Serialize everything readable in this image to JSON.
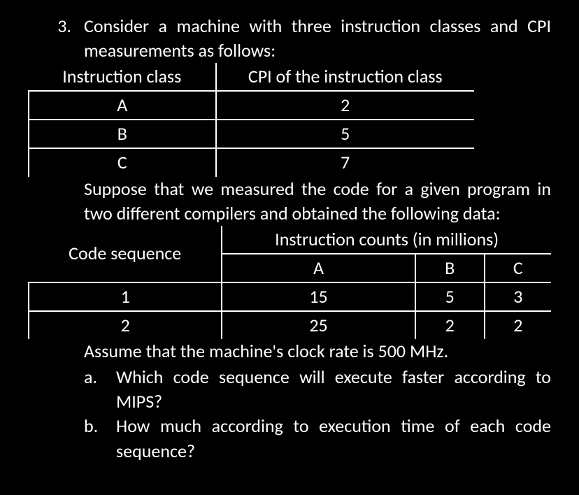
{
  "problem": {
    "number": "3.",
    "intro": "Consider a machine with three instruction classes and CPI measurements as follows:",
    "table1": {
      "headers": [
        "Instruction class",
        "CPI of the instruction class"
      ],
      "rows": [
        {
          "class": "A",
          "cpi": "2"
        },
        {
          "class": "B",
          "cpi": "5"
        },
        {
          "class": "C",
          "cpi": "7"
        }
      ]
    },
    "mid_para": "Suppose that we measured the code for a given program in two different compilers and obtained the following data:",
    "table2": {
      "top_header_left": "Code sequence",
      "top_header_right": "Instruction counts (in millions)",
      "sub_headers": [
        "A",
        "B",
        "C"
      ],
      "rows": [
        {
          "seq": "1",
          "a": "15",
          "b": "5",
          "c": "3"
        },
        {
          "seq": "2",
          "a": "25",
          "b": "2",
          "c": "2"
        }
      ]
    },
    "assume": "Assume that the machine's clock rate is 500 MHz.",
    "parts": [
      {
        "label": "a.",
        "text": "Which code sequence will execute faster according to MIPS?"
      },
      {
        "label": "b.",
        "text": "How much according to execution time of each code sequence?"
      }
    ]
  }
}
